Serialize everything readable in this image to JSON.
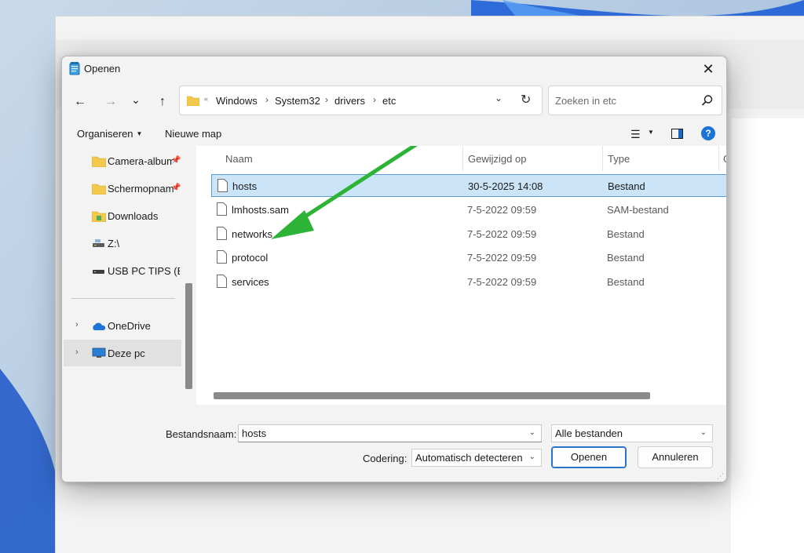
{
  "dialog": {
    "title": "Openen",
    "close_icon": "close-icon"
  },
  "nav": {
    "back_icon": "←",
    "forward_icon": "→",
    "recent_icon": "⌄",
    "up_icon": "↑"
  },
  "address": {
    "breadcrumbs": [
      "Windows",
      "System32",
      "drivers",
      "etc"
    ],
    "search_placeholder": "Zoeken in etc"
  },
  "toolbar": {
    "organize_label": "Organiseren",
    "new_folder_label": "Nieuwe map",
    "help_label": "?"
  },
  "sidebar": {
    "items": [
      {
        "label": "Camera-album",
        "icon": "folder-icon",
        "pinned": true
      },
      {
        "label": "Schermopnames",
        "icon": "folder-icon",
        "pinned": true
      },
      {
        "label": "Downloads",
        "icon": "downloads-folder-icon",
        "pinned": false
      },
      {
        "label": "Z:\\",
        "icon": "network-drive-icon",
        "pinned": false
      },
      {
        "label": "USB PC TIPS (E:)",
        "icon": "usb-drive-icon",
        "pinned": false
      },
      {
        "label": "OneDrive",
        "icon": "onedrive-icon",
        "pinned": false
      },
      {
        "label": "Deze pc",
        "icon": "computer-icon",
        "pinned": false
      }
    ]
  },
  "filelist": {
    "columns": [
      "Naam",
      "Gewijzigd op",
      "Type",
      "G"
    ],
    "rows": [
      {
        "name": "hosts",
        "modified": "30-5-2025 14:08",
        "type": "Bestand",
        "selected": true
      },
      {
        "name": "lmhosts.sam",
        "modified": "7-5-2022 09:59",
        "type": "SAM-bestand",
        "selected": false
      },
      {
        "name": "networks",
        "modified": "7-5-2022 09:59",
        "type": "Bestand",
        "selected": false
      },
      {
        "name": "protocol",
        "modified": "7-5-2022 09:59",
        "type": "Bestand",
        "selected": false
      },
      {
        "name": "services",
        "modified": "7-5-2022 09:59",
        "type": "Bestand",
        "selected": false
      }
    ]
  },
  "bottom": {
    "filename_label": "Bestandsnaam:",
    "filename_value": "hosts",
    "filter_value": "Alle bestanden",
    "encoding_label": "Codering:",
    "encoding_value": "Automatisch detecteren",
    "open_label": "Openen",
    "cancel_label": "Annuleren"
  },
  "colors": {
    "accent": "#1a73d6",
    "selection": "#cce4f7",
    "annotation_arrow": "#2db336"
  }
}
